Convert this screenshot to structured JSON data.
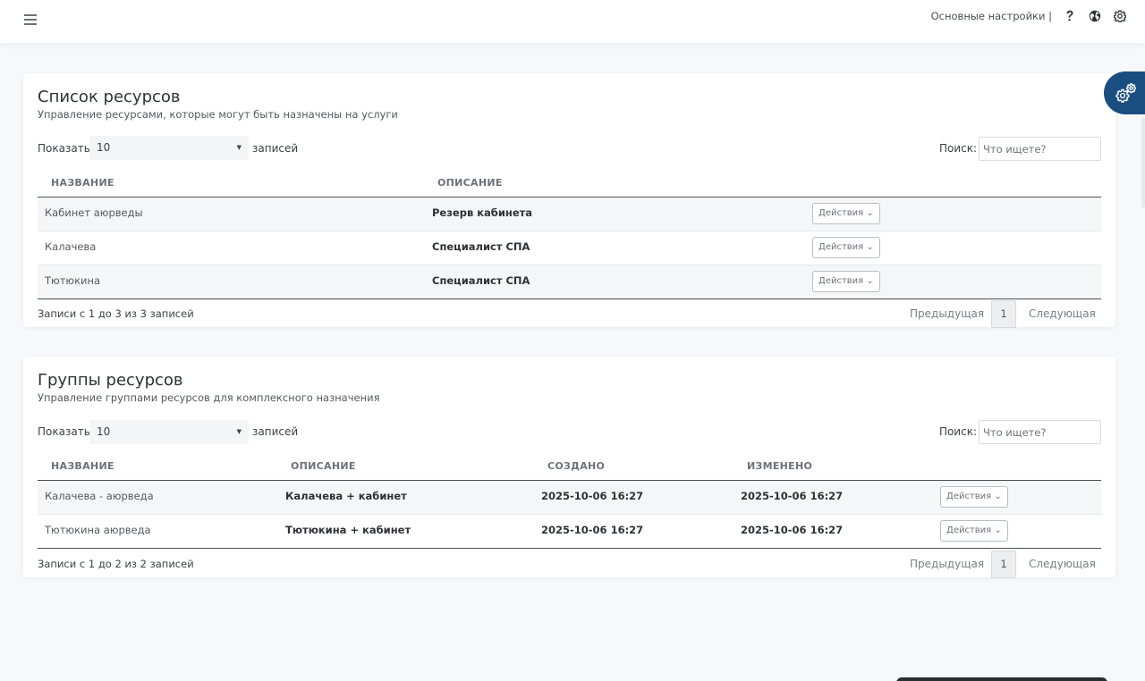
{
  "topbar": {
    "settings_link": "Основные настройки |",
    "icons": [
      "hamburger-icon",
      "help-icon",
      "globe-icon",
      "gear-icon"
    ]
  },
  "resources": {
    "title": "Список ресурсов",
    "subtitle": "Управление ресурсами, которые могут быть назначены на услуги",
    "length_label": "Показать",
    "length_value": "10",
    "length_after": "записей",
    "search_label": "Поиск:",
    "search_placeholder": "Что ищете?",
    "columns": [
      "НАЗВАНИЕ",
      "ОПИСАНИЕ"
    ],
    "rows": [
      {
        "name": "Кабинет аюрведы",
        "description": "Резерв кабинета",
        "action": "Действия"
      },
      {
        "name": "Калачева",
        "description": "Специалист СПА",
        "action": "Действия"
      },
      {
        "name": "Тютюкина",
        "description": "Специалист СПА",
        "action": "Действия"
      }
    ],
    "info": "Записи с 1 до 3 из 3 записей",
    "prev": "Предыдущая",
    "page": "1",
    "next": "Следующая"
  },
  "groups": {
    "title": "Группы ресурсов",
    "subtitle": "Управление группами ресурсов для комплексного назначения",
    "length_label": "Показать",
    "length_value": "10",
    "length_after": "записей",
    "search_label": "Поиск:",
    "search_placeholder": "Что ищете?",
    "columns": [
      "НАЗВАНИЕ",
      "ОПИСАНИЕ",
      "СОЗДАНО",
      "ИЗМЕНЕНО"
    ],
    "rows": [
      {
        "name": "Калачева - аюрведа",
        "description": "Калачева + кабинет",
        "created": "2025-10-06 16:27",
        "modified": "2025-10-06 16:27",
        "action": "Действия"
      },
      {
        "name": "Тютюкина аюрведа",
        "description": "Тютюкина + кабинет",
        "created": "2025-10-06 16:27",
        "modified": "2025-10-06 16:27",
        "action": "Действия"
      }
    ],
    "info": "Записи с 1 до 2 из 2 записей",
    "prev": "Предыдущая",
    "page": "1",
    "next": "Следующая"
  },
  "colors": {
    "accent": "#1b4e80",
    "background": "#f7f8fb"
  }
}
